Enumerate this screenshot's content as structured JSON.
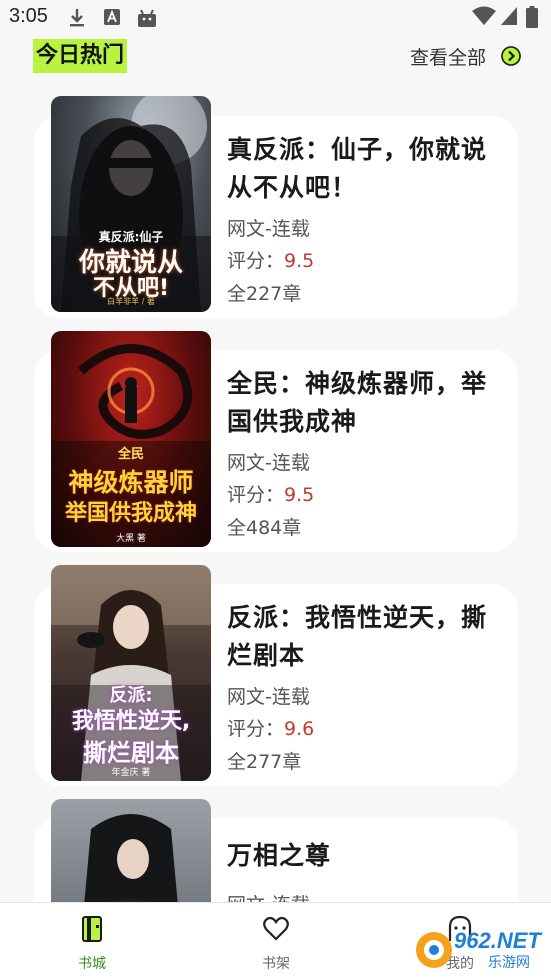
{
  "status_bar": {
    "time": "3:05",
    "left_icons": [
      "download-icon",
      "text-a-icon",
      "android-icon"
    ],
    "right_icons": [
      "wifi-icon",
      "signal-icon",
      "battery-icon"
    ]
  },
  "header": {
    "title": "今日热门",
    "view_all_label": "查看全部",
    "view_all_icon": "chevron-right-circle-icon",
    "highlight_color": "#b7f33f"
  },
  "books": [
    {
      "title_line1": "真反派：仙子，你就说",
      "title_line2": "从不从吧！",
      "category": "网文-连载",
      "score_label": "评分：",
      "score": "9.5",
      "chapters": "全227章",
      "cover_text_top": "真反派:仙子",
      "cover_text_main1": "你就说从",
      "cover_text_main2": "不从吧!",
      "cover_author": "白羊非羊 / 著"
    },
    {
      "title_line1": "全民：神级炼器师，举",
      "title_line2": "国供我成神",
      "category": "网文-连载",
      "score_label": "评分：",
      "score": "9.5",
      "chapters": "全484章",
      "cover_text_top": "全民",
      "cover_text_main1": "神级炼器师",
      "cover_text_main2": "举国供我成神",
      "cover_author": "大黑 著"
    },
    {
      "title_line1": "反派：我悟性逆天，撕",
      "title_line2": "烂剧本",
      "category": "网文-连载",
      "score_label": "评分：",
      "score": "9.6",
      "chapters": "全277章",
      "cover_text_top": "反派:",
      "cover_text_main1": "我悟性逆天,",
      "cover_text_main2": "撕烂剧本",
      "cover_author": "年金庆 著"
    },
    {
      "title_line1": "万相之尊",
      "category": "网文-连载"
    }
  ],
  "bottom_nav": {
    "items": [
      {
        "label": "书城",
        "icon": "book-icon",
        "active": true
      },
      {
        "label": "书架",
        "icon": "heart-icon",
        "active": false
      },
      {
        "label": "我的",
        "icon": "face-icon",
        "active": false
      }
    ],
    "active_color": "#3a8f1c"
  },
  "watermark": {
    "main": "962.NET",
    "sub": "乐游网"
  }
}
